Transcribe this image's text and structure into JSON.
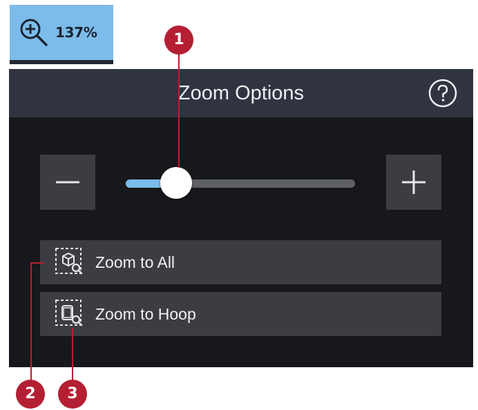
{
  "zoom_indicator": {
    "icon": "zoom-in-icon",
    "value_label": "137%"
  },
  "panel": {
    "title": "Zoom Options",
    "help_icon": "question-circle-icon"
  },
  "slider": {
    "minus_icon": "minus-icon",
    "plus_icon": "plus-icon",
    "fraction": 0.22
  },
  "actions": [
    {
      "label": "Zoom to All",
      "icon": "zoom-to-all-icon"
    },
    {
      "label": "Zoom to Hoop",
      "icon": "zoom-to-hoop-icon"
    }
  ],
  "callouts": [
    "1",
    "2",
    "3"
  ],
  "colors": {
    "accent": "#7cbcea",
    "panel_bg": "#17181b",
    "header_bg": "#2f3440",
    "button_bg": "#3c3d43",
    "callout": "#b51f33"
  }
}
